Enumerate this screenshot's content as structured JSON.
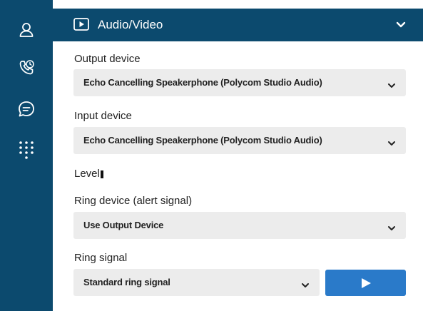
{
  "sidebar": {
    "items": [
      {
        "icon": "user-icon"
      },
      {
        "icon": "phone-history-icon"
      },
      {
        "icon": "chat-icon"
      },
      {
        "icon": "dialpad-icon"
      }
    ],
    "background": "#0c4a6e"
  },
  "section": {
    "icon": "video-play-icon",
    "title": "Audio/Video",
    "expanded_icon": "chevron-down-icon"
  },
  "output_device": {
    "label": "Output device",
    "value": "Echo Cancelling Speakerphone (Polycom Studio Audio)"
  },
  "input_device": {
    "label": "Input device",
    "value": "Echo Cancelling Speakerphone (Polycom Studio Audio)"
  },
  "level": {
    "label": "Level"
  },
  "ring_device": {
    "label": "Ring device (alert signal)",
    "value": "Use Output Device"
  },
  "ring_signal": {
    "label": "Ring signal",
    "value": "Standard ring signal",
    "play_icon": "play-icon"
  },
  "colors": {
    "header": "#0c4a6e",
    "select_bg": "#ececec",
    "accent": "#2a7ac9"
  }
}
